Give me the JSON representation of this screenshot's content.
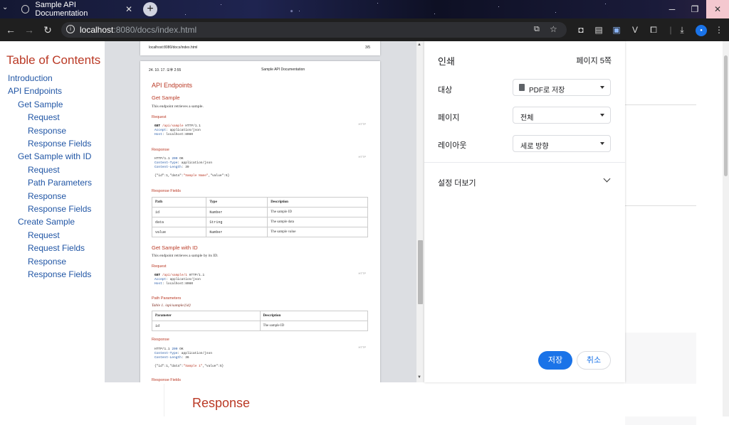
{
  "browser": {
    "tab_title": "Sample API Documentation",
    "url_host": "localhost",
    "url_path": ":8080/docs/index.html",
    "window_buttons": [
      "─",
      "❐",
      "✕"
    ]
  },
  "toc": {
    "title": "Table of Contents",
    "items": [
      {
        "label": "Introduction",
        "level": 1
      },
      {
        "label": "API Endpoints",
        "level": 1
      },
      {
        "label": "Get Sample",
        "level": 2
      },
      {
        "label": "Request",
        "level": 3
      },
      {
        "label": "Response",
        "level": 3
      },
      {
        "label": "Response Fields",
        "level": 3
      },
      {
        "label": "Get Sample with ID",
        "level": 2
      },
      {
        "label": "Request",
        "level": 3
      },
      {
        "label": "Path Parameters",
        "level": 3
      },
      {
        "label": "Response",
        "level": 3
      },
      {
        "label": "Response Fields",
        "level": 3
      },
      {
        "label": "Create Sample",
        "level": 2
      },
      {
        "label": "Request",
        "level": 3
      },
      {
        "label": "Request Fields",
        "level": 3
      },
      {
        "label": "Response",
        "level": 3
      },
      {
        "label": "Response Fields",
        "level": 3
      }
    ]
  },
  "page_behind": {
    "response_heading": "Response"
  },
  "preview": {
    "prev_sheet_url": "localhost:8080/docs/index.html",
    "prev_sheet_page": "3/5",
    "header_date": "24. 10. 17. 오후 2:55",
    "header_title": "Sample API Documentation",
    "api_endpoints": "API Endpoints",
    "get_sample": "Get Sample",
    "get_sample_desc": "This endpoint retrieves a sample.",
    "request": "Request",
    "response": "Response",
    "response_fields": "Response Fields",
    "http_tag": "HTTP",
    "req1": {
      "method": "GET",
      "path": "/api/sample",
      "proto": " HTTP/1.1",
      "accept_k": "Accept",
      "accept_v": ": application/json",
      "host_k": "Host",
      "host_v": ": localhost:8080"
    },
    "resp1": {
      "status": "HTTP/1.1 ",
      "code": "200",
      "ok": " OK",
      "ct_k": "Content-Type",
      "ct_v": ": application/json",
      "cl_k": "Content-Length",
      "cl_v": ": 39",
      "body_a": "{\"id\":1,\"data\":",
      "body_b": "\"Sample Name\"",
      "body_c": ",\"value\":5}"
    },
    "fields_table": {
      "headers": [
        "Path",
        "Type",
        "Description"
      ],
      "rows": [
        [
          "id",
          "Number",
          "The sample ID"
        ],
        [
          "data",
          "String",
          "The sample data"
        ],
        [
          "value",
          "Number",
          "The sample value"
        ]
      ]
    },
    "get_sample_id": "Get Sample with ID",
    "get_sample_id_desc": "This endpoint retrieves a sample by its ID.",
    "req2": {
      "method": "GET",
      "path": "/api/sample/1",
      "proto": " HTTP/1.1",
      "accept_k": "Accept",
      "accept_v": ": application/json",
      "host_k": "Host",
      "host_v": ": localhost:8080"
    },
    "path_parameters": "Path Parameters",
    "table_caption": "Table 1. /api/sample/{id}",
    "params_table": {
      "headers": [
        "Parameter",
        "Description"
      ],
      "rows": [
        [
          "id",
          "The sample ID"
        ]
      ]
    },
    "resp2": {
      "status": "HTTP/1.1 ",
      "code": "200",
      "ok": " OK",
      "ct_k": "Content-Type",
      "ct_v": ": application/json",
      "cl_k": "Content-Length",
      "cl_v": ": 36",
      "body_a": "{\"id\":1,\"data\":",
      "body_b": "\"Sample 1\"",
      "body_c": ",\"value\":5}"
    },
    "response_fields_cut": "Response Fields"
  },
  "print_settings": {
    "title": "인쇄",
    "page_count": "페이지 5쪽",
    "destination_label": "대상",
    "destination_value": "PDF로 저장",
    "pages_label": "페이지",
    "pages_value": "전체",
    "layout_label": "레이아웃",
    "layout_value": "세로 방향",
    "more_settings": "설정 더보기",
    "save_button": "저장",
    "cancel_button": "취소"
  }
}
